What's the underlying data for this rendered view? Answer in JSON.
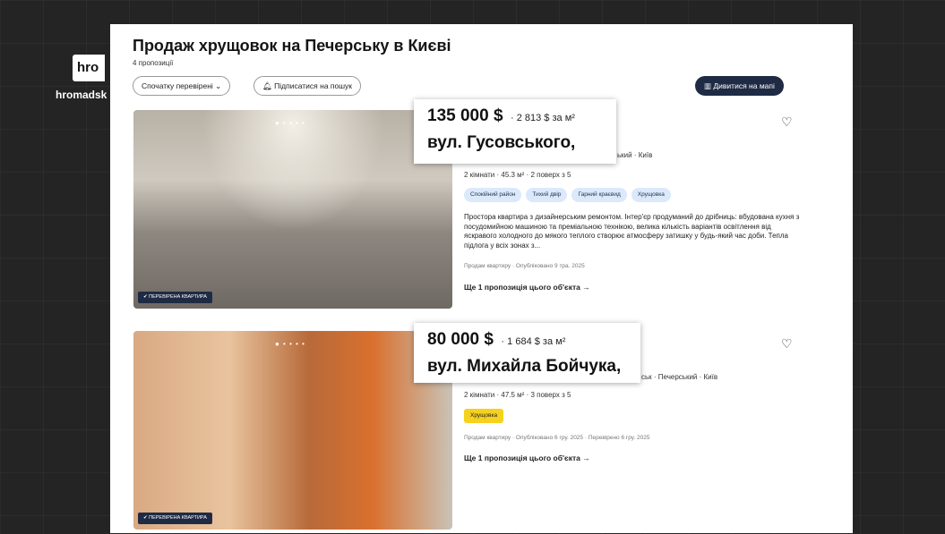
{
  "brand": {
    "logo_short": "hro",
    "logo_text": "hromadsk"
  },
  "header": {
    "title": "Продаж хрущовок на Печерську в Києві",
    "count": "4 пропозиції",
    "sort_label": "Спочатку перевірені",
    "subscribe_label": "Підписатися на пошук",
    "map_label": "Дивитися на мапі"
  },
  "listings": [
    {
      "price": "135 000 $",
      "price_per_m2": "2 813 $ за м²",
      "street": "вул. Гусовського,",
      "location_tail": "ький · Київ",
      "details": "2 кімнати · 45.3 м² · 2 поверх з 5",
      "tags": [
        "Спокійний район",
        "Тихий двір",
        "Гарний краєвид",
        "Хрущовка"
      ],
      "description": "Простора квартира з дизайнерським ремонтом. Інтер'єр продуманий до дрібниць: вбудована кухня з посудомийною машиною та преміальною технікою, велика кількість варіантів освітлення від яскравого холодного до мякого теплого створює атмосферу затишку у будь-який час доби. Тепла підлога у всіх зонах з...",
      "posted": "Продам квартиру · Опубліковано 9 тра. 2025",
      "more_label": "Ще 1 пропозиція цього об'єкта →",
      "badge": "ПЕРЕВІРЕНА КВАРТИРА"
    },
    {
      "price": "80 000 $",
      "price_per_m2": "1 684 $ за м²",
      "street": "вул. Михайла Бойчука,",
      "location_tail": "ськ · Печерський · Київ",
      "details": "2 кімнати · 47.5 м² · 3 поверх з 5",
      "tags": [
        "Хрущовка"
      ],
      "posted": "Продам квартиру · Опубліковано 6 гру. 2025 · Перевірено 6 гру. 2025",
      "more_label": "Ще 1 пропозиція цього об'єкта →",
      "badge": "ПЕРЕВІРЕНА КВАРТИРА"
    }
  ],
  "icons": {
    "heart": "heart-icon",
    "map": "map-icon",
    "bell": "bell-icon",
    "chevron": "chevron-down-icon",
    "check": "verified-icon"
  },
  "colors": {
    "navy": "#1f2b44",
    "tag_blue": "#dbe9fb",
    "tag_yellow": "#f6d11d"
  }
}
